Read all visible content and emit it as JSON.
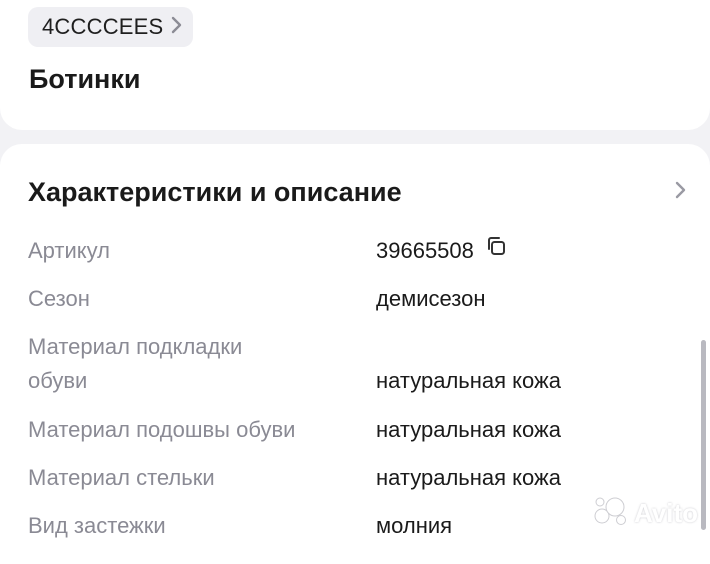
{
  "header": {
    "brand_chip": "4CCCCEES",
    "product_title": "Ботинки"
  },
  "section": {
    "title": "Характеристики и описание",
    "icons": {
      "expand": "chevron-right-icon",
      "copy": "copy-icon"
    }
  },
  "specs": [
    {
      "key": "Артикул",
      "value": "39665508"
    },
    {
      "key": "Сезон",
      "value": "демисезон"
    },
    {
      "key_line1": "Материал подкладки",
      "key_line2": "обуви",
      "value": "натуральная кожа"
    },
    {
      "key": "Материал подошвы обуви",
      "value": "натуральная кожа"
    },
    {
      "key": "Материал стельки",
      "value": "натуральная кожа"
    },
    {
      "key": "Вид застежки",
      "value": "молния"
    }
  ],
  "watermark": {
    "text": "Avito"
  },
  "colors": {
    "background": "#f2f2f5",
    "card": "#ffffff",
    "muted_text": "#8a8a94",
    "chip_bg": "#efeff3"
  }
}
